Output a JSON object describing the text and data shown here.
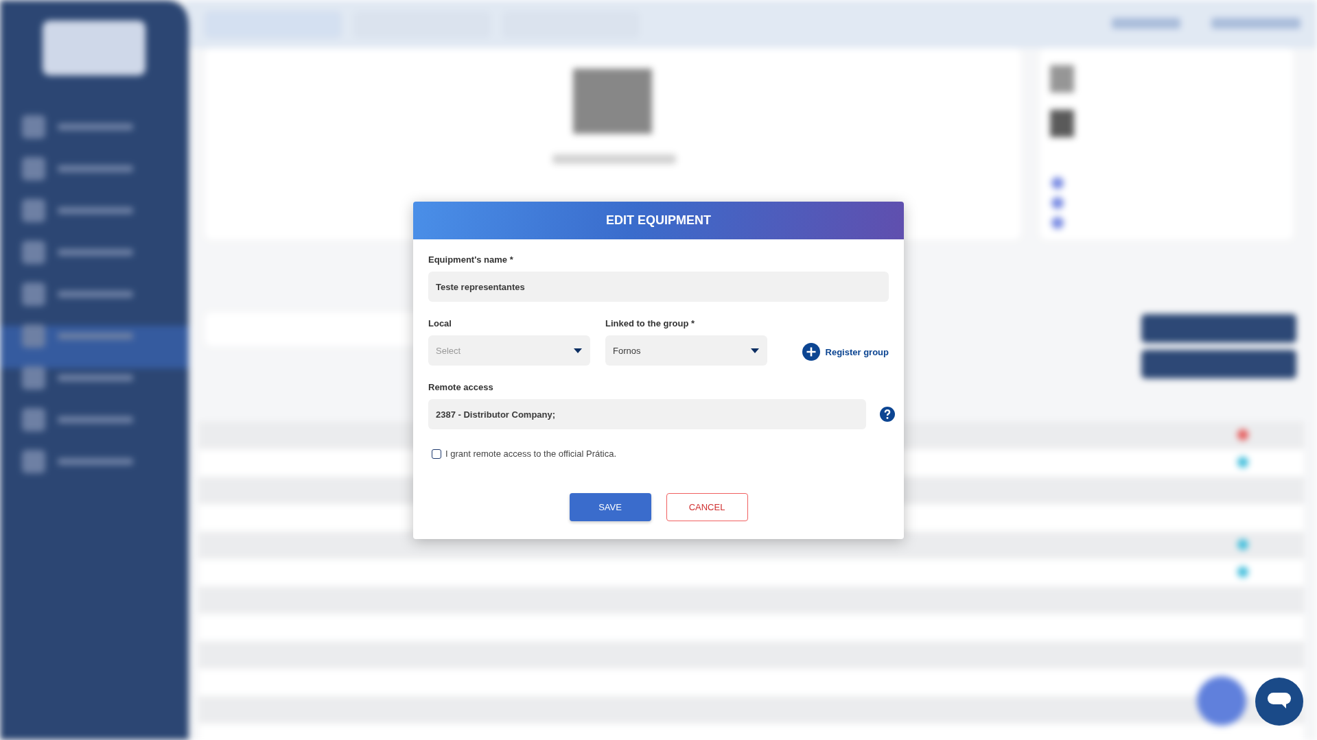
{
  "dialog": {
    "title": "EDIT EQUIPMENT",
    "name_field": {
      "label": "Equipment's name *",
      "value": "Teste representantes"
    },
    "local_field": {
      "label": "Local",
      "placeholder": "Select"
    },
    "group_field": {
      "label": "Linked to the group *",
      "value": "Fornos"
    },
    "register_group_button": {
      "label": "Register group"
    },
    "remote_access_field": {
      "label": "Remote access",
      "value": "2387 - Distributor Company;"
    },
    "grant_checkbox": {
      "label": "I grant remote access to the official Prática.",
      "checked": false
    },
    "buttons": [
      {
        "label": "SAVE",
        "kind": "primary"
      },
      {
        "label": "CANCEL",
        "kind": "secondary"
      }
    ]
  }
}
